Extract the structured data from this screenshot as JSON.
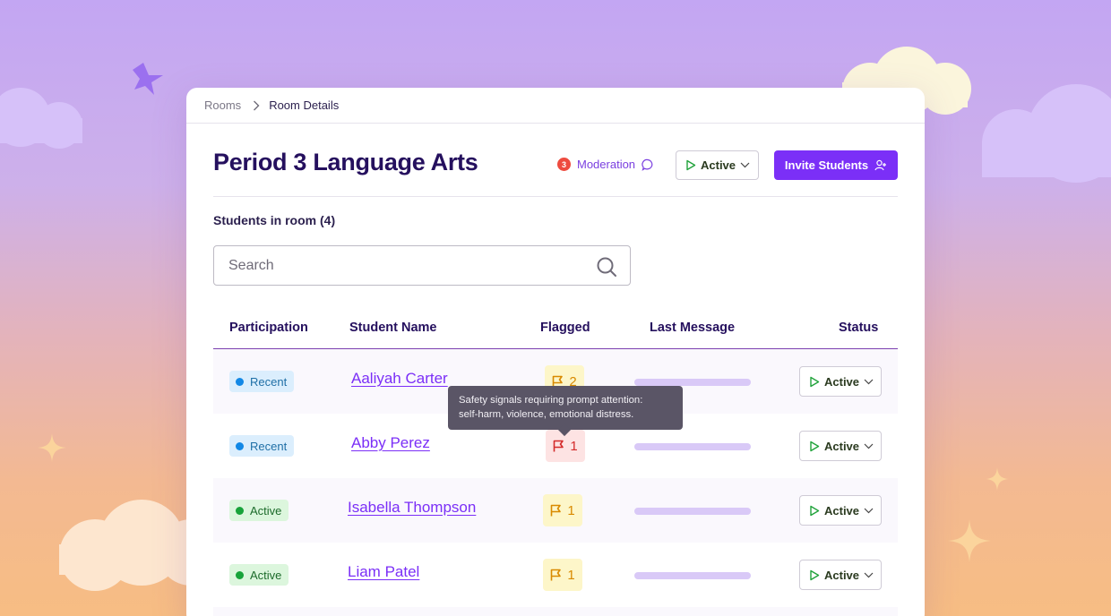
{
  "breadcrumb": {
    "root": "Rooms",
    "current": "Room Details"
  },
  "header": {
    "title": "Period 3 Language Arts",
    "moderation_count": "3",
    "moderation_label": "Moderation",
    "status_label": "Active",
    "invite_label": "Invite Students"
  },
  "room": {
    "count_label": "Students in room (4)"
  },
  "search": {
    "placeholder": "Search",
    "value": ""
  },
  "table": {
    "columns": [
      "Participation",
      "Student Name",
      "Flagged",
      "Last Message",
      "Status"
    ],
    "rows": [
      {
        "participation": "Recent",
        "name": "Aaliyah Carter",
        "flags": "2",
        "flag_level": "warning",
        "status": "Active"
      },
      {
        "participation": "Recent",
        "name": "Abby Perez",
        "flags": "1",
        "flag_level": "safety",
        "status": "Active"
      },
      {
        "participation": "Active",
        "name": "Isabella Thompson",
        "flags": "1",
        "flag_level": "warning",
        "status": "Active"
      },
      {
        "participation": "Active",
        "name": "Liam Patel",
        "flags": "1",
        "flag_level": "warning",
        "status": "Active"
      }
    ]
  },
  "tooltip": {
    "line1": "Safety signals requiring prompt attention:",
    "line2": "self-harm, violence, emotional distress."
  },
  "colors": {
    "accent": "#7b2ff7",
    "title": "#25105e",
    "recent_badge": "#dbeefd",
    "active_badge": "#dcf6dd",
    "flag_warning": "#fdf6c9",
    "flag_safety": "#fde3e3",
    "moderation_badge": "#ee4b3f"
  },
  "icons": [
    "chevron-right-icon",
    "chat-bubble-icon",
    "play-icon",
    "chevron-down-icon",
    "user-plus-icon",
    "search-icon",
    "flag-icon"
  ]
}
